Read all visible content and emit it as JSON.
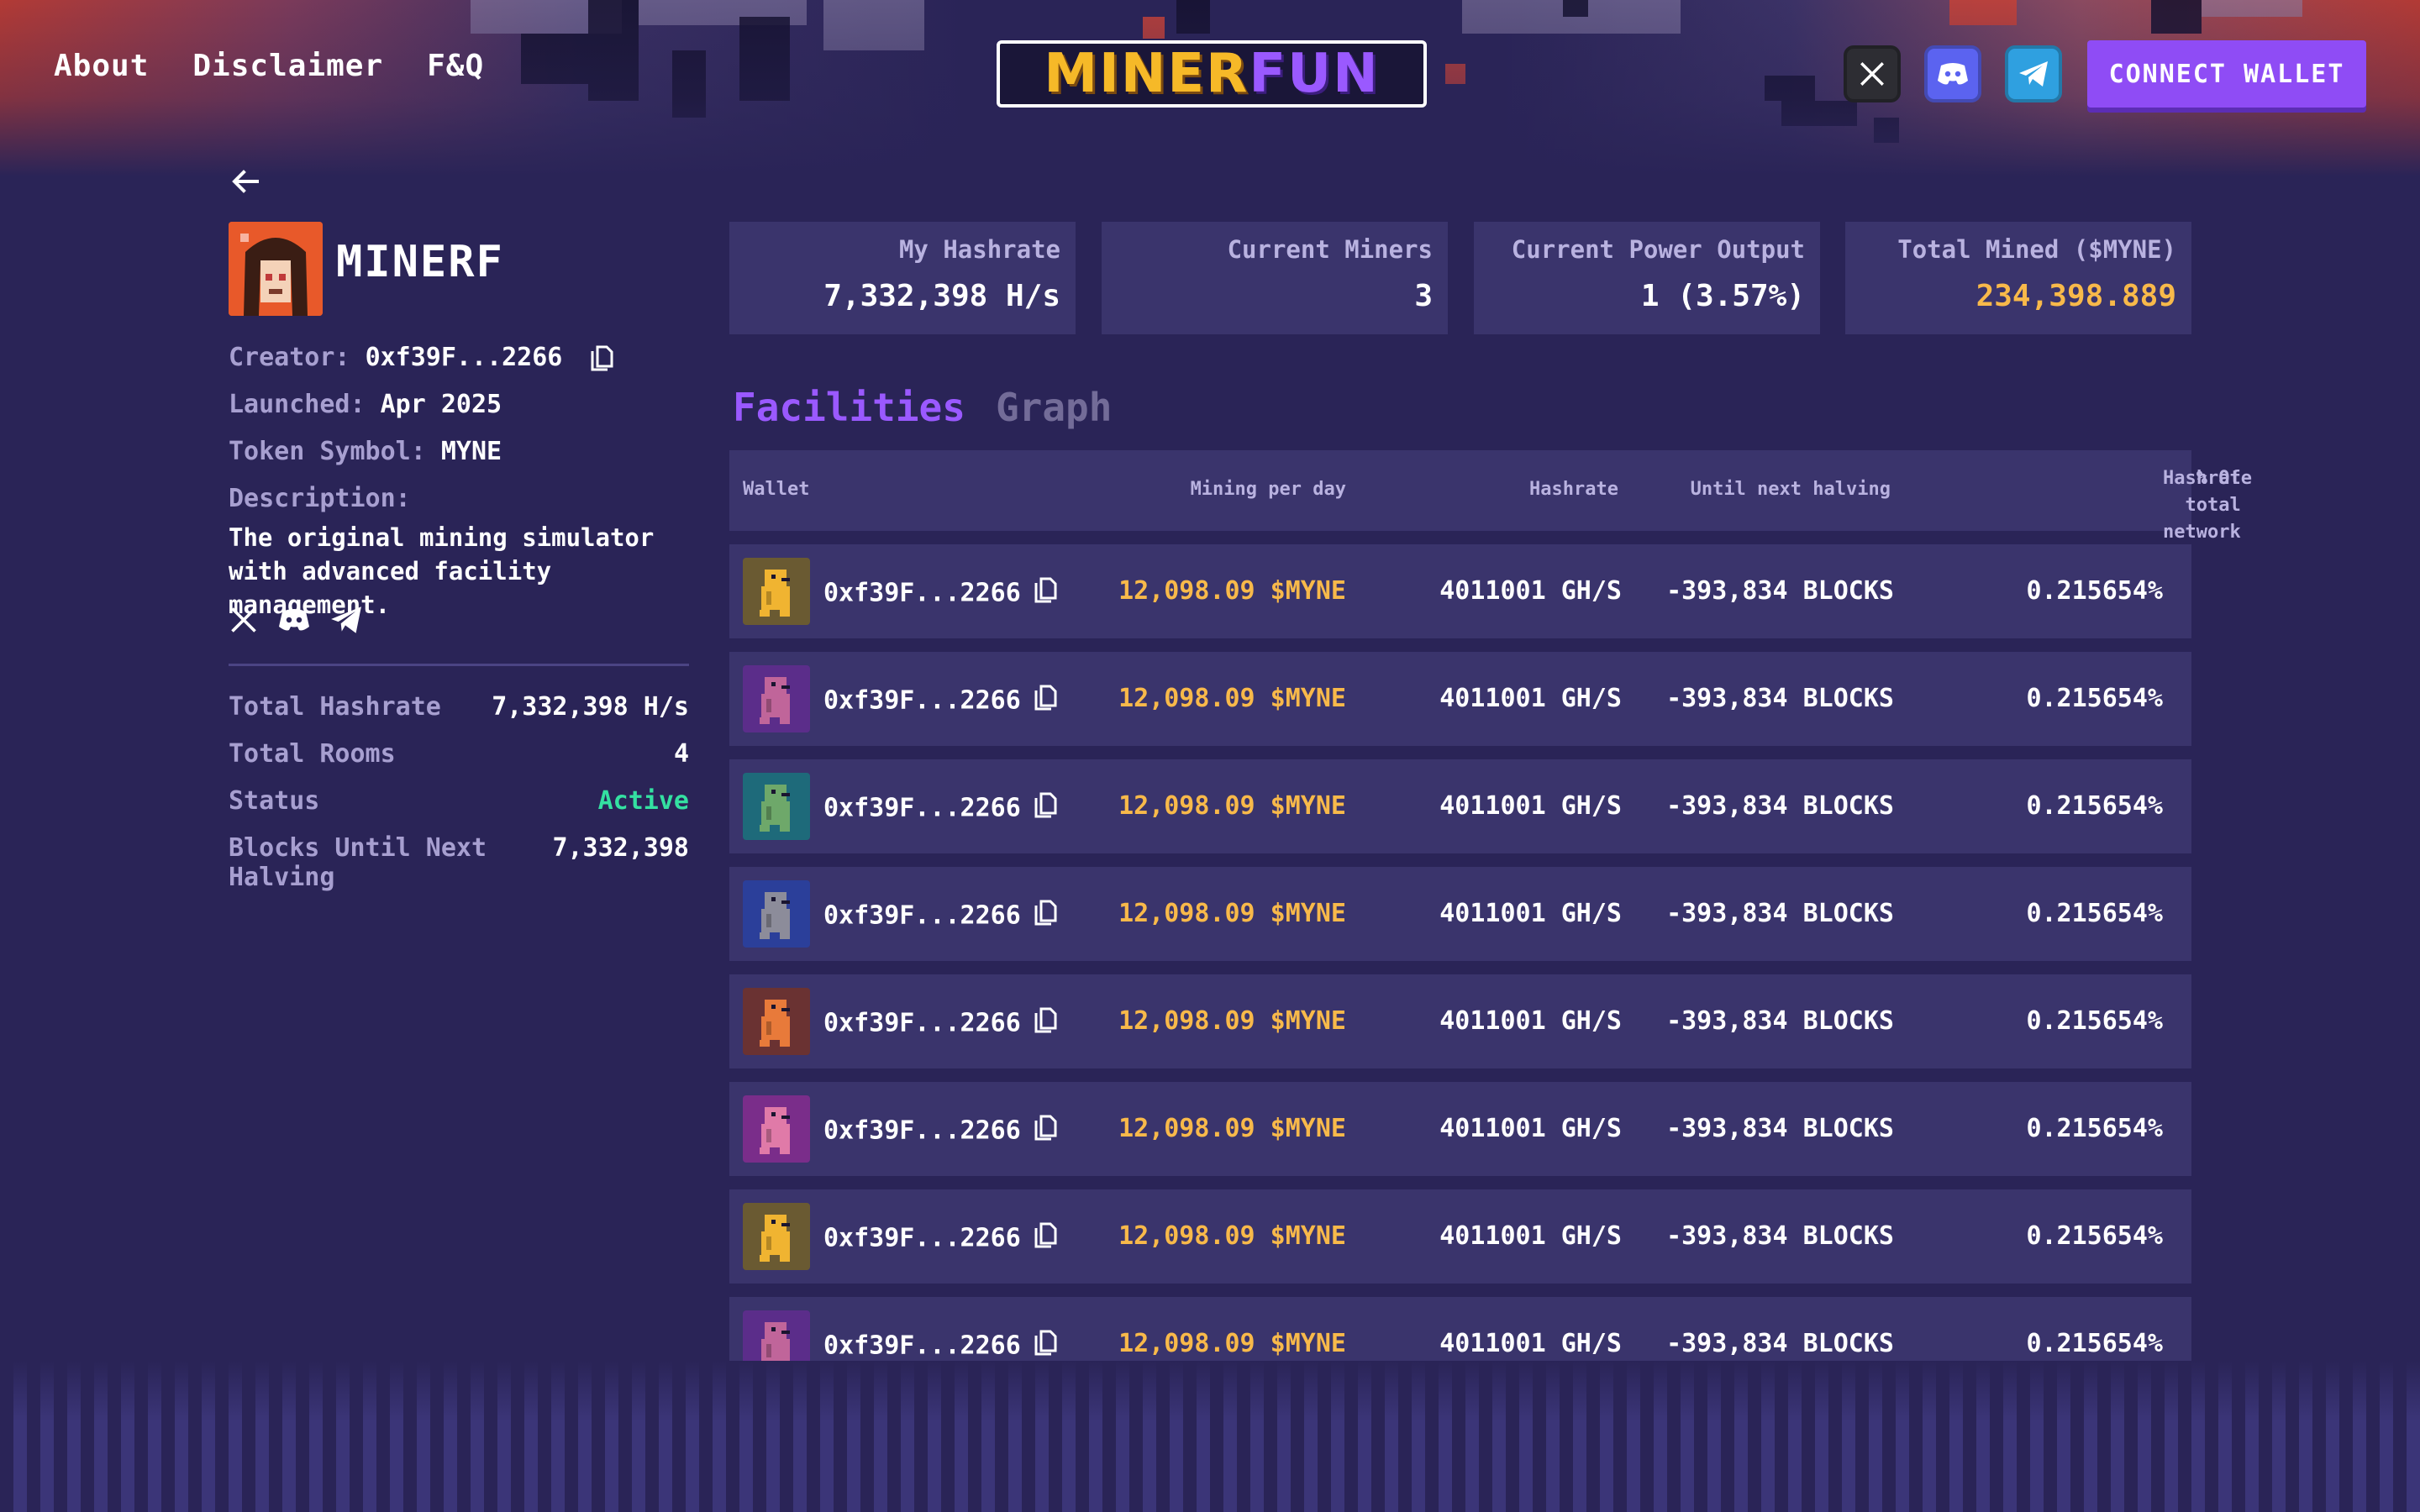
{
  "nav": {
    "about": "About",
    "disclaimer": "Disclaimer",
    "faq": "F&Q"
  },
  "logo": {
    "part1": "MINER",
    "part2": "FUN"
  },
  "header": {
    "connect_wallet": "CONNECT WALLET"
  },
  "project": {
    "name": "MINERF",
    "creator_label": "Creator:",
    "creator_value": "0xf39F...2266",
    "launched_label": "Launched:",
    "launched_value": "Apr 2025",
    "symbol_label": "Token Symbol:",
    "symbol_value": "MYNE",
    "description_label": "Description:",
    "description": "The original mining simulator with advanced facility management."
  },
  "stats": {
    "total_hashrate_label": "Total Hashrate",
    "total_hashrate_value": "7,332,398 H/s",
    "total_rooms_label": "Total Rooms",
    "total_rooms_value": "4",
    "status_label": "Status",
    "status_value": "Active",
    "blocks_label": "Blocks Until Next Halving",
    "blocks_value": "7,332,398"
  },
  "cards": [
    {
      "label": "My Hashrate",
      "value": "7,332,398 H/s"
    },
    {
      "label": "Current Miners",
      "value": "3"
    },
    {
      "label": "Current Power Output",
      "value": "1 (3.57%)"
    },
    {
      "label": "Total Mined ($MYNE)",
      "value": "234,398.889"
    }
  ],
  "tabs": {
    "facilities": "Facilities",
    "graph": "Graph"
  },
  "table": {
    "headers": {
      "wallet": "Wallet",
      "mining": "Mining per day",
      "hashrate": "Hashrate",
      "halving": "Until next halving",
      "pct_line1": "% Of total network",
      "pct_line2": "Hashrate"
    },
    "rows": [
      {
        "wallet": "0xf39F...2266",
        "mining": "12,098.09 $MYNE",
        "hashrate": "4011001 GH/S",
        "halving": "-393,834 BLOCKS",
        "pct": "0.215654%",
        "tile": "#6a5a32",
        "miner": "#f0b431"
      },
      {
        "wallet": "0xf39F...2266",
        "mining": "12,098.09 $MYNE",
        "hashrate": "4011001 GH/S",
        "halving": "-393,834 BLOCKS",
        "pct": "0.215654%",
        "tile": "#5b2d8a",
        "miner": "#c0659a"
      },
      {
        "wallet": "0xf39F...2266",
        "mining": "12,098.09 $MYNE",
        "hashrate": "4011001 GH/S",
        "halving": "-393,834 BLOCKS",
        "pct": "0.215654%",
        "tile": "#1e6a7a",
        "miner": "#6ea86a"
      },
      {
        "wallet": "0xf39F...2266",
        "mining": "12,098.09 $MYNE",
        "hashrate": "4011001 GH/S",
        "halving": "-393,834 BLOCKS",
        "pct": "0.215654%",
        "tile": "#2b3f9a",
        "miner": "#8c8c9a"
      },
      {
        "wallet": "0xf39F...2266",
        "mining": "12,098.09 $MYNE",
        "hashrate": "4011001 GH/S",
        "halving": "-393,834 BLOCKS",
        "pct": "0.215654%",
        "tile": "#6a3232",
        "miner": "#e87a3a"
      },
      {
        "wallet": "0xf39F...2266",
        "mining": "12,098.09 $MYNE",
        "hashrate": "4011001 GH/S",
        "halving": "-393,834 BLOCKS",
        "pct": "0.215654%",
        "tile": "#7a2d8a",
        "miner": "#e07aa8"
      },
      {
        "wallet": "0xf39F...2266",
        "mining": "12,098.09 $MYNE",
        "hashrate": "4011001 GH/S",
        "halving": "-393,834 BLOCKS",
        "pct": "0.215654%",
        "tile": "#6a5a32",
        "miner": "#f0b431"
      },
      {
        "wallet": "0xf39F...2266",
        "mining": "12,098.09 $MYNE",
        "hashrate": "4011001 GH/S",
        "halving": "-393,834 BLOCKS",
        "pct": "0.215654%",
        "tile": "#5b2d8a",
        "miner": "#c0659a"
      }
    ]
  },
  "icons": {
    "back": "arrow-left-icon",
    "copy": "copy-icon",
    "x": "x-logo-icon",
    "discord": "discord-icon",
    "telegram": "telegram-icon"
  },
  "colors": {
    "background": "#2a2457",
    "card": "#3a346c",
    "accent": "#9a59ff",
    "gold": "#f8b94a",
    "status_active": "#34e0a1"
  }
}
